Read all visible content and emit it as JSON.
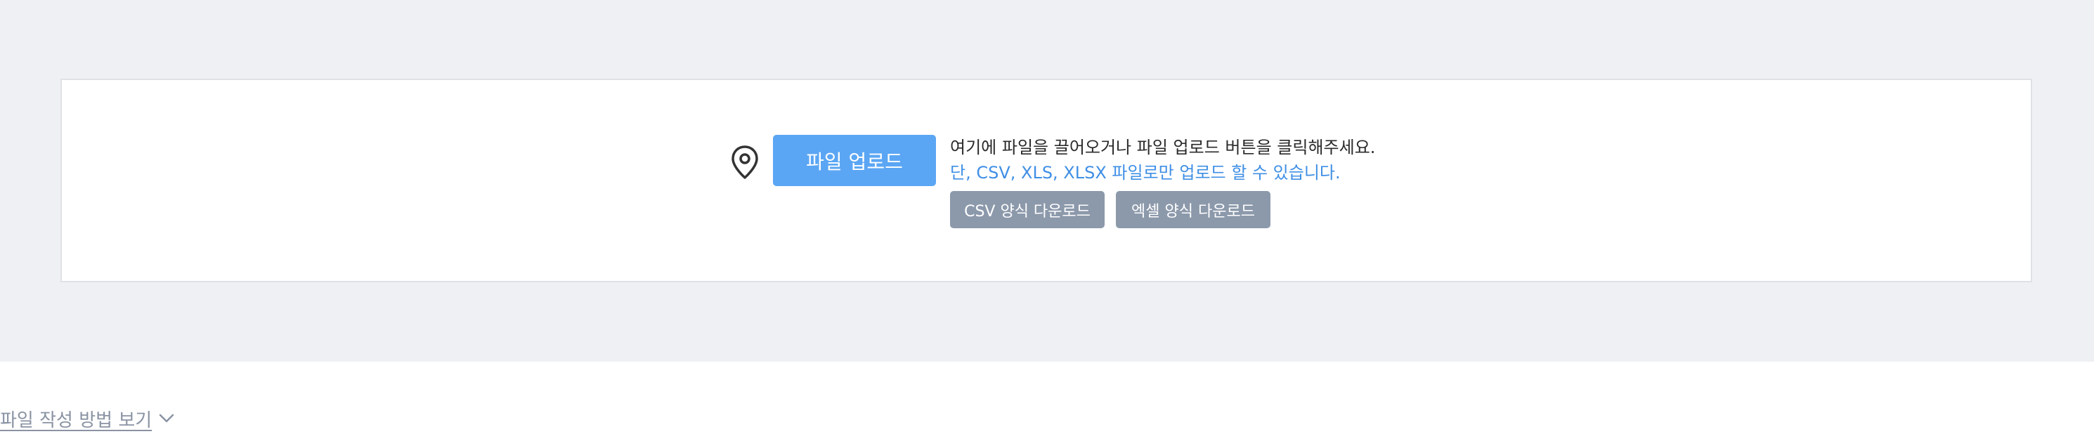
{
  "upload": {
    "button_label": "파일 업로드",
    "hint_main": "여기에 파일을 끌어오거나 파일 업로드 버튼을 클릭해주세요.",
    "hint_sub": "단, CSV, XLS, XLSX 파일로만 업로드 할 수 있습니다.",
    "csv_template_label": "CSV 양식 다운로드",
    "excel_template_label": "엑셀 양식 다운로드",
    "icon": "map-pin-icon"
  },
  "guide": {
    "label": "파일 작성 방법 보기",
    "icon": "chevron-down-icon"
  },
  "colors": {
    "page_background": "#eff0f3",
    "primary_button": "#5ba6f4",
    "secondary_button": "#8c99ab",
    "hint_highlight": "#3f8fe5"
  }
}
